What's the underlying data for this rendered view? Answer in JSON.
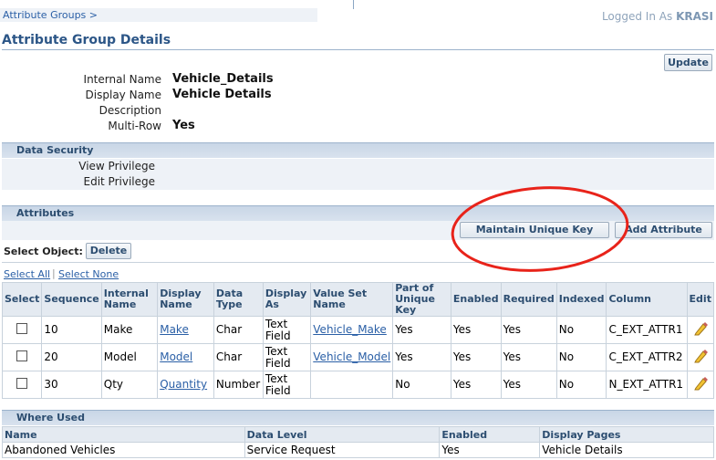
{
  "breadcrumb": "Attribute Groups >",
  "logged_in_prefix": "Logged In As",
  "logged_in_user": "KRASI",
  "page_title": "Attribute Group Details",
  "update_label": "Update",
  "details": {
    "internal_name_label": "Internal Name",
    "internal_name": "Vehicle_Details",
    "display_name_label": "Display Name",
    "display_name": "Vehicle Details",
    "description_label": "Description",
    "description": "",
    "multi_row_label": "Multi-Row",
    "multi_row": "Yes"
  },
  "data_security": {
    "title": "Data Security",
    "view_privilege_label": "View Privilege",
    "edit_privilege_label": "Edit Privilege"
  },
  "attributes": {
    "title": "Attributes",
    "maintain_unique_key_label": "Maintain Unique Key",
    "add_attribute_label": "Add Attribute",
    "select_object_label": "Select Object:",
    "delete_label": "Delete",
    "select_all_label": "Select All",
    "select_none_label": "Select None",
    "headers": [
      "Select",
      "Sequence",
      "Internal Name",
      "Display Name",
      "Data Type",
      "Display As",
      "Value Set Name",
      "Part of Unique Key",
      "Enabled",
      "Required",
      "Indexed",
      "Column",
      "Edit"
    ],
    "rows": [
      {
        "sequence": "10",
        "internal": "Make",
        "display": "Make",
        "type": "Char",
        "display_as": "Text Field",
        "value_set": "Vehicle_Make",
        "unique": "Yes",
        "enabled": "Yes",
        "required": "Yes",
        "indexed": "No",
        "column": "C_EXT_ATTR1"
      },
      {
        "sequence": "20",
        "internal": "Model",
        "display": "Model",
        "type": "Char",
        "display_as": "Text Field",
        "value_set": "Vehicle_Model",
        "unique": "Yes",
        "enabled": "Yes",
        "required": "Yes",
        "indexed": "No",
        "column": "C_EXT_ATTR2"
      },
      {
        "sequence": "30",
        "internal": "Qty",
        "display": "Quantity",
        "type": "Number",
        "display_as": "Text Field",
        "value_set": "",
        "unique": "No",
        "enabled": "Yes",
        "required": "Yes",
        "indexed": "No",
        "column": "N_EXT_ATTR1"
      }
    ]
  },
  "where_used": {
    "title": "Where Used",
    "headers": [
      "Name",
      "Data Level",
      "Enabled",
      "Display Pages"
    ],
    "rows": [
      {
        "name": "Abandoned Vehicles",
        "level": "Service Request",
        "enabled": "Yes",
        "pages": "Vehicle Details"
      }
    ]
  },
  "annotation_color": "#e8231a"
}
